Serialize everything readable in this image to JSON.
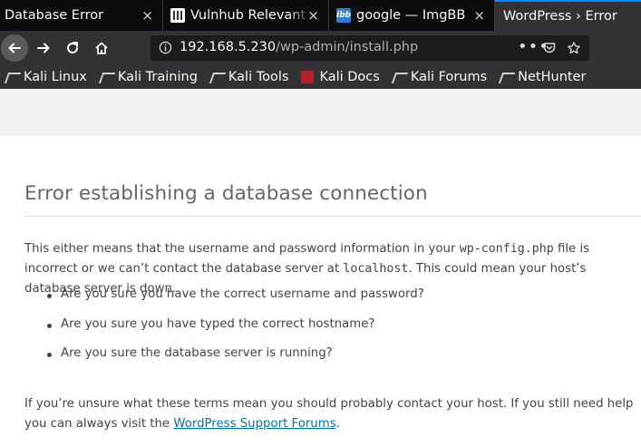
{
  "browser": {
    "tabs": [
      {
        "title": "Database Error",
        "active": false
      },
      {
        "title": "Vulnhub Relevant b",
        "active": false
      },
      {
        "title": "google — ImgBB",
        "active": false
      },
      {
        "title": "WordPress › Error",
        "active": true
      }
    ],
    "close_glyph": "×",
    "url": {
      "host": "192.168.5.230",
      "path": "/wp-admin/install.php"
    },
    "bookmarks": [
      {
        "label": "Kali Linux",
        "icon": "kali-dragon-icon"
      },
      {
        "label": "Kali Training",
        "icon": "kali-dragon-icon"
      },
      {
        "label": "Kali Tools",
        "icon": "kali-dragon-icon"
      },
      {
        "label": "Kali Docs",
        "icon": "kali-docs-icon"
      },
      {
        "label": "Kali Forums",
        "icon": "kali-dragon-icon"
      },
      {
        "label": "NetHunter",
        "icon": "nethunter-icon"
      }
    ]
  },
  "page": {
    "heading": "Error establishing a database connection",
    "para1": {
      "t1": "This either means that the username and password information in your ",
      "code1": "wp-config.php",
      "t2": " file is incorrect or we can’t contact the database server at ",
      "code2": "localhost",
      "t3": ". This could mean your host’s database server is down."
    },
    "checklist": [
      "Are you sure you have the correct username and password?",
      "Are you sure you have typed the correct hostname?",
      "Are you sure the database server is running?"
    ],
    "para2": {
      "t1": "If you’re unsure what these terms mean you should probably contact your host. If you still need help you can always visit the ",
      "link": "WordPress Support Forums",
      "t2": "."
    }
  },
  "colors": {
    "link": "#0073aa",
    "active_tab_accent": "#0a84ff",
    "toolbar_bg": "#323234",
    "tabbar_bg": "#0c0c0d"
  }
}
